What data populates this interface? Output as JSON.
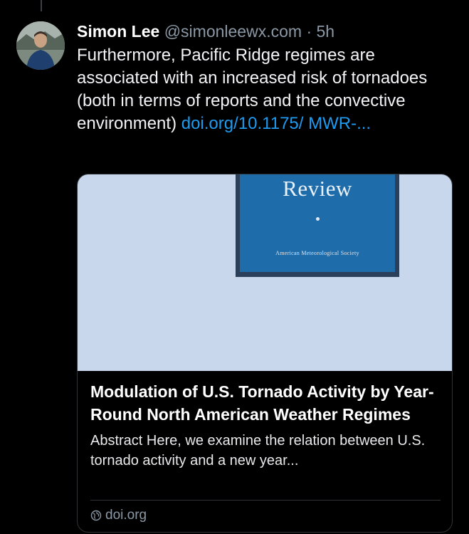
{
  "post": {
    "author": {
      "name": "Simon Lee",
      "handle": "@simonleewx.com",
      "separator": "·",
      "time": "5h"
    },
    "text": "Furthermore, Pacific Ridge regimes are associated with an increased risk of tornadoes (both in terms of reports and the convective environment) ",
    "link_text": "doi.org/10.1175/ MWR-...",
    "link_preview": {
      "image": {
        "cover_title": "Review",
        "cover_subtitle": "American Meteorological Society"
      },
      "title": "Modulation of U.S. Tornado Activity by Year-Round North American Weather Regimes",
      "description": "Abstract Here, we examine the relation between U.S. tornado activity and a new year...",
      "domain": "doi.org",
      "domain_icon": "globe-icon"
    }
  },
  "colors": {
    "background": "#000000",
    "link": "#1d9bf0",
    "muted": "#8b98a5",
    "card_border": "#2f3336",
    "image_background": "#c9d7ec",
    "cover_blue": "#1f6cab"
  }
}
